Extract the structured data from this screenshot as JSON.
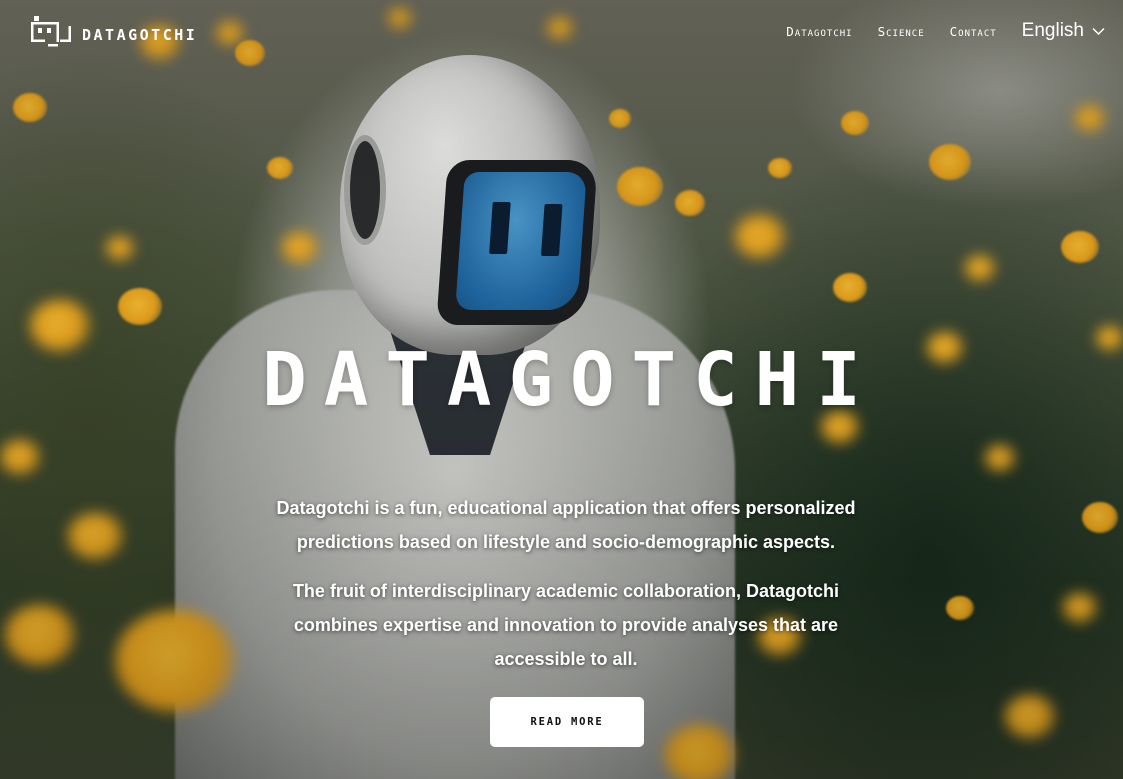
{
  "brand": {
    "name": "DATAGOTCHI",
    "logo_icon": "robot-head-icon"
  },
  "nav": {
    "links": [
      "Datagotchi",
      "Science",
      "Contact"
    ],
    "language": {
      "label": "English",
      "icon": "chevron-down-icon"
    }
  },
  "hero": {
    "title": "DATAGOTCHI",
    "paragraphs": [
      "Datagotchi is a fun, educational application that offers personalized predictions based on lifestyle and socio-demographic aspects.",
      "The fruit of interdisciplinary academic collaboration, Datagotchi combines expertise and innovation to provide analyses that are accessible to all."
    ],
    "cta_label": "Read more"
  },
  "colors": {
    "text": "#ffffff",
    "button_bg": "#ffffff",
    "button_text": "#111111",
    "screen_blue": "#2f7fbf",
    "flower_yellow": "#e8a21c"
  }
}
